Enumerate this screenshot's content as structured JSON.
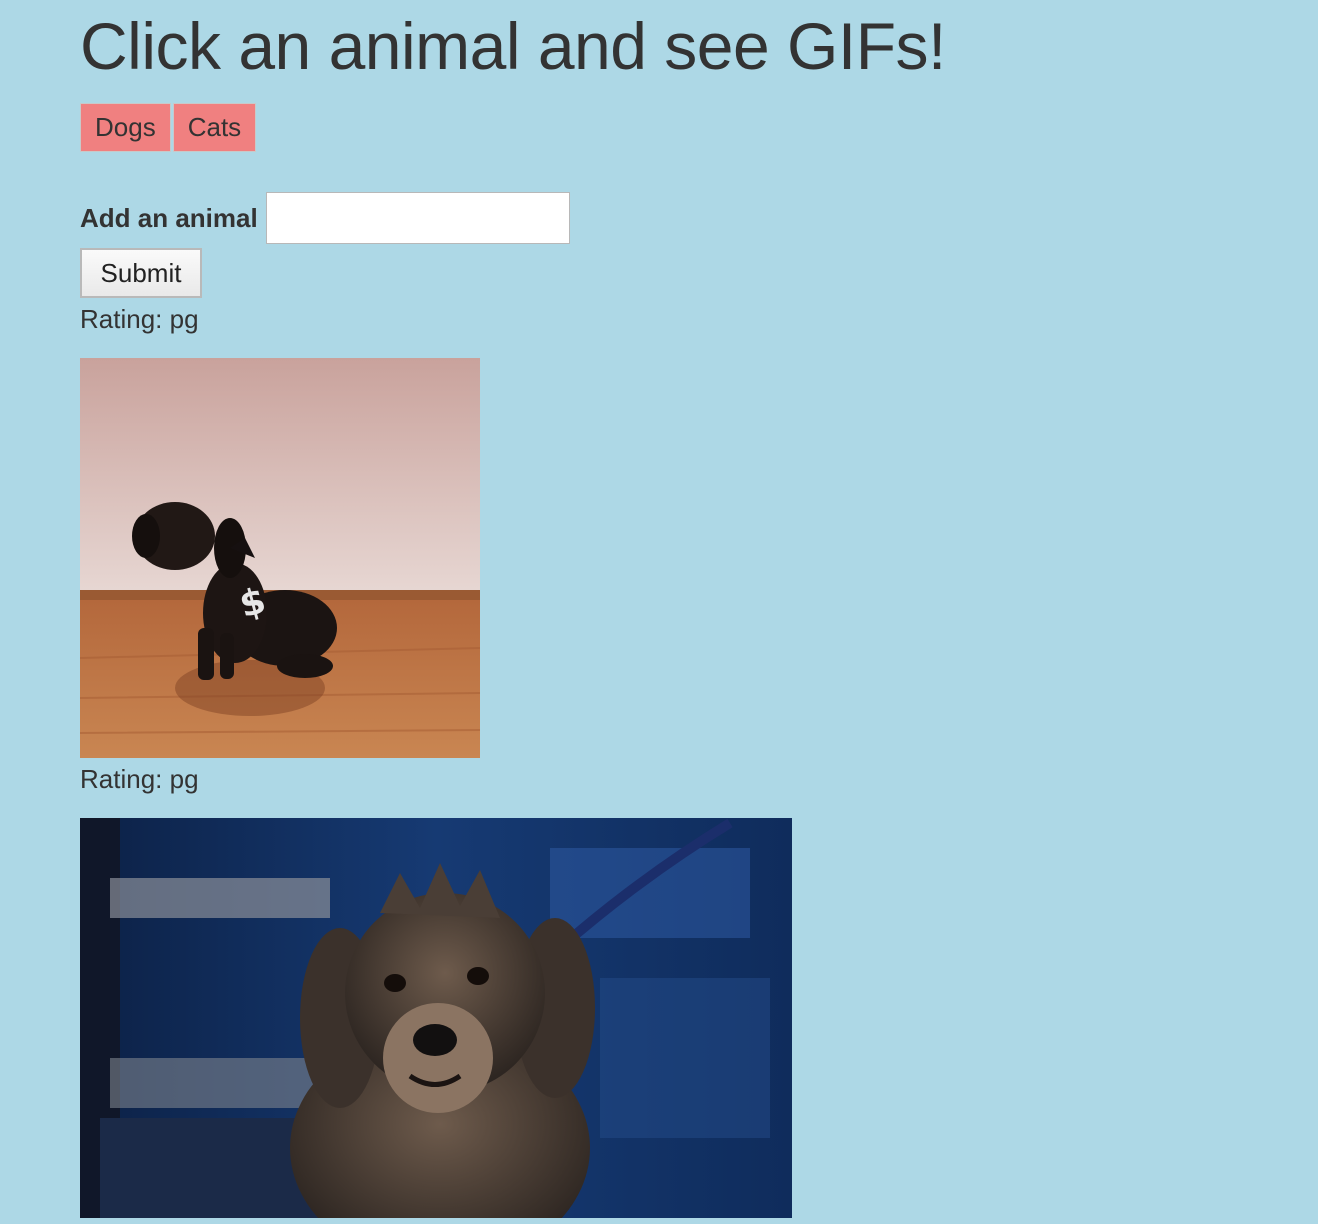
{
  "header": {
    "title": "Click an animal and see GIFs!"
  },
  "animal_buttons": [
    {
      "label": "Dogs"
    },
    {
      "label": "Cats"
    }
  ],
  "form": {
    "label": "Add an animal",
    "input_value": "",
    "input_placeholder": "",
    "submit_label": "Submit"
  },
  "gifs": [
    {
      "rating_text": "Rating: pg",
      "subject": "black dachshund sitting on wooden floor"
    },
    {
      "rating_text": "Rating: pg",
      "subject": "scruffy gray terrier on leash"
    }
  ],
  "colors": {
    "background": "#add8e6",
    "button_bg": "#f08080",
    "text": "#333333"
  }
}
